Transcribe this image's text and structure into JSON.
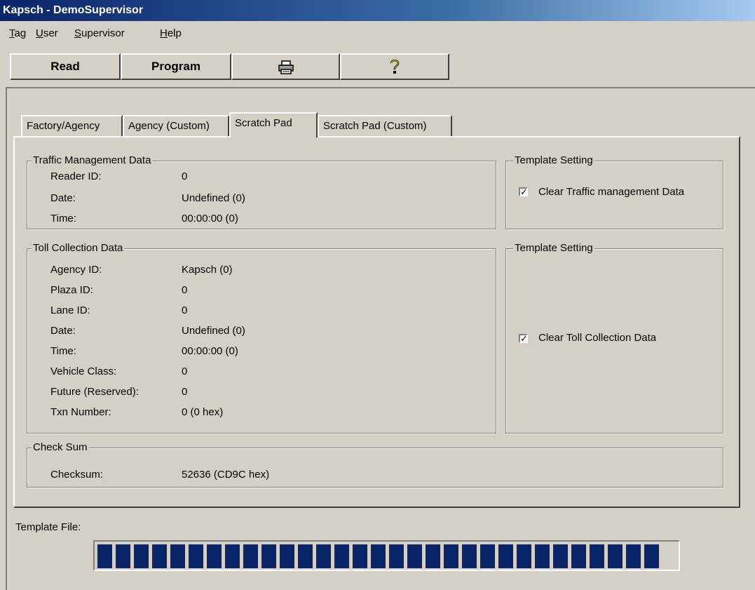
{
  "window": {
    "title": "Kapsch - DemoSupervisor"
  },
  "menu": [
    {
      "mnemonic": "T",
      "rest": "ag"
    },
    {
      "mnemonic": "U",
      "rest": "ser"
    },
    {
      "mnemonic": "S",
      "rest": "upervisor"
    },
    {
      "mnemonic": "H",
      "rest": "elp"
    }
  ],
  "toolbar": {
    "read_label": "Read",
    "program_label": "Program",
    "print_icon": "printer-icon",
    "help_icon": "question-icon"
  },
  "tabs": [
    {
      "label": "Factory/Agency"
    },
    {
      "label": "Agency (Custom)"
    },
    {
      "label": "Scratch Pad",
      "active": true
    },
    {
      "label": "Scratch Pad (Custom)"
    }
  ],
  "traffic": {
    "title": "Traffic Management Data",
    "rows": [
      {
        "label": "Reader ID:",
        "value": "0"
      },
      {
        "label": "Date:",
        "value": "Undefined (0)"
      },
      {
        "label": "Time:",
        "value": "00:00:00 (0)"
      }
    ]
  },
  "template1": {
    "title": "Template Setting",
    "checkbox_label": "Clear Traffic management Data",
    "checked": true
  },
  "toll": {
    "title": "Toll Collection Data",
    "rows": [
      {
        "label": "Agency ID:",
        "value": "Kapsch (0)"
      },
      {
        "label": "Plaza ID:",
        "value": "0"
      },
      {
        "label": "Lane ID:",
        "value": "0"
      },
      {
        "label": "Date:",
        "value": "Undefined (0)"
      },
      {
        "label": "Time:",
        "value": "00:00:00 (0)"
      },
      {
        "label": "Vehicle Class:",
        "value": "0"
      },
      {
        "label": "Future (Reserved):",
        "value": "0"
      },
      {
        "label": "Txn Number:",
        "value": "0 (0 hex)"
      }
    ]
  },
  "template2": {
    "title": "Template Setting",
    "checkbox_label": "Clear Toll Collection Data",
    "checked": true
  },
  "checksum": {
    "title": "Check Sum",
    "label": "Checksum:",
    "value": "52636 (CD9C hex)"
  },
  "template_file": {
    "label": "Template File:",
    "progress": 1.0
  },
  "colors": {
    "title_bar": "#0a246a",
    "progress": "#0a246a",
    "face": "#d4d0c8"
  }
}
